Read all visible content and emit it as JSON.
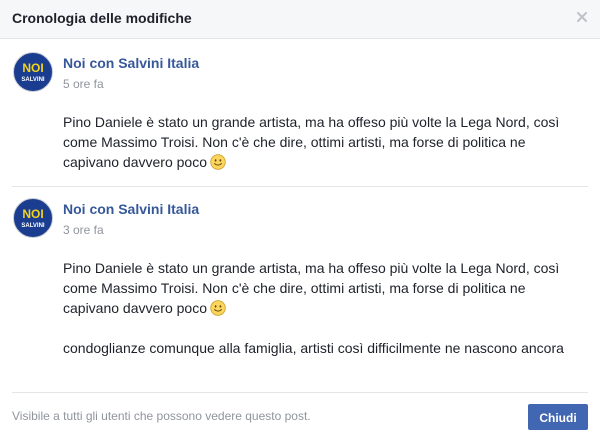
{
  "dialog": {
    "title": "Cronologia delle modifiche",
    "close_icon": "close-icon"
  },
  "revisions": [
    {
      "author": "Noi con Salvini Italia",
      "avatar_text_top": "NOI",
      "avatar_text_bottom": "SALVINI",
      "time": "5 ore fa",
      "paragraphs": [
        "Pino Daniele è stato un grande artista, ma ha offeso più volte la Lega Nord, così come Massimo Troisi. Non c'è che dire, ottimi artisti, ma forse di politica ne capivano davvero poco"
      ],
      "emoji": "smile-emoji-icon"
    },
    {
      "author": "Noi con Salvini Italia",
      "avatar_text_top": "NOI",
      "avatar_text_bottom": "SALVINI",
      "time": "3 ore fa",
      "paragraphs": [
        "Pino Daniele è stato un grande artista, ma ha offeso più volte la Lega Nord, così come Massimo Troisi. Non c'è che dire, ottimi artisti, ma forse di politica ne capivano davvero poco",
        "condoglianze comunque alla famiglia, artisti così difficilmente ne nascono ancora"
      ],
      "emoji": "smile-emoji-icon"
    }
  ],
  "footer": {
    "visibility_text": "Visibile a tutti gli utenti che possono vedere questo post.",
    "close_button_label": "Chiudi"
  },
  "colors": {
    "header_bg": "#f6f7f9",
    "link_blue": "#365899",
    "button_blue": "#4267b2",
    "text": "#1d2129",
    "muted": "#90949c",
    "avatar_blue": "#1a3d8f",
    "avatar_yellow": "#f5d31a"
  }
}
